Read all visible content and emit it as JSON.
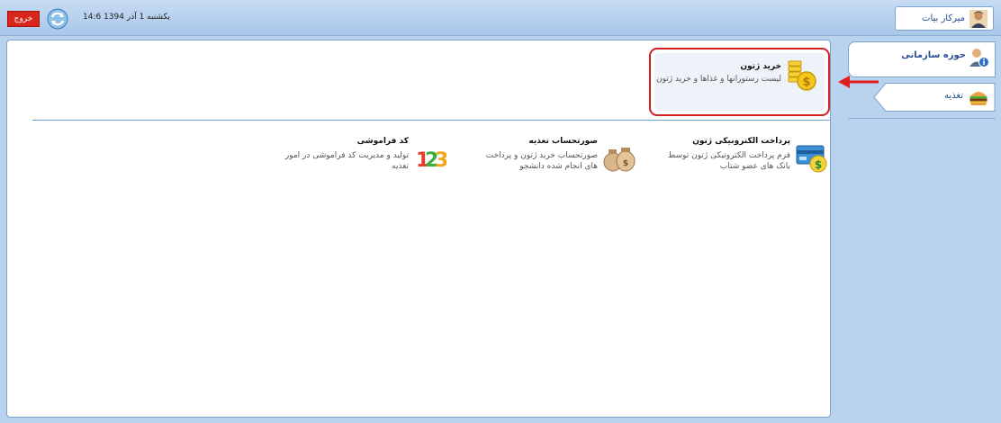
{
  "header": {
    "logout_label": "خروج",
    "datetime": "14:6 یکشنبه 1 آذر 1394",
    "user_name": "میرکار بیات"
  },
  "featured": {
    "title": "خرید ژتون",
    "description": "لیست رستورانها و غذاها و خرید ژتون"
  },
  "cards": [
    {
      "title": "پرداخت الکترونیکی ژتون",
      "description": "فرم پرداخت الکترونیکی ژتون توسط بانک های عضو شتاب",
      "icon": "electronic-payment-icon"
    },
    {
      "title": "صورتحساب تغذیه",
      "description": "صورتحساب خرید ژتون و پرداخت های انجام شده دانشجو",
      "icon": "invoice-money-bags-icon"
    },
    {
      "title": "کد فراموشی",
      "description": "تولید و مدیریت کد فراموشی در امور تغذیه",
      "icon": "numbers-123-icon"
    }
  ],
  "sidebar": {
    "org_label": "حوزه سازمانی",
    "food_label": "تغذیه"
  },
  "colors": {
    "logout_red": "#d9261c",
    "highlight_red": "#d32020",
    "page_bg": "#b9d3ef",
    "accent_blue": "#2a4d8f"
  }
}
